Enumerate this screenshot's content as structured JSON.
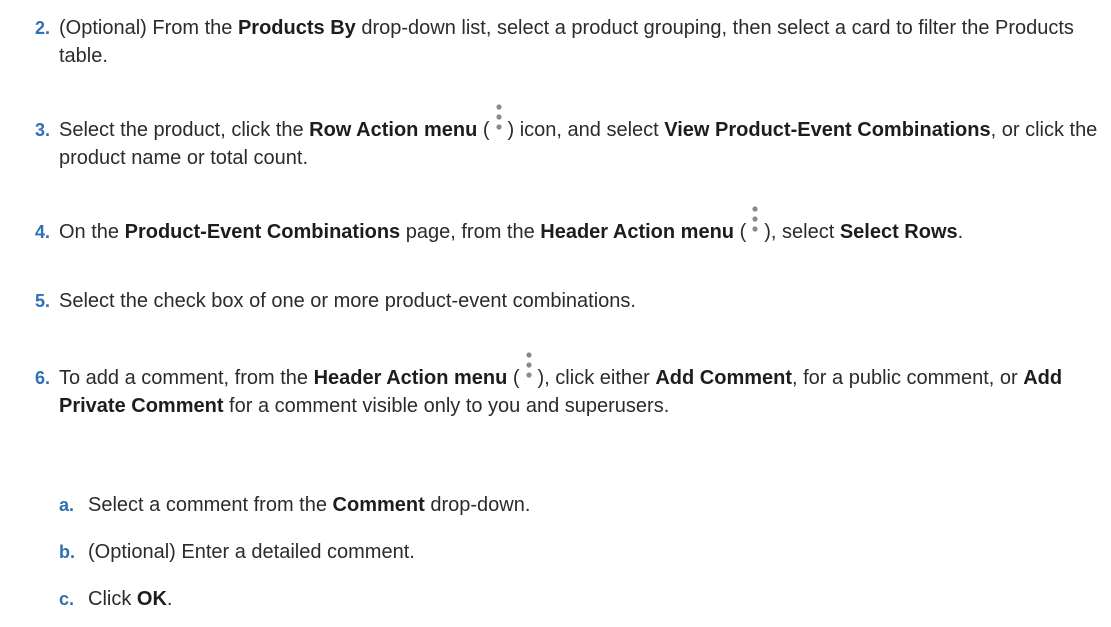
{
  "steps": [
    {
      "number": "2.",
      "parts": [
        {
          "text": "(Optional) From the "
        },
        {
          "text": "Products By",
          "bold": true
        },
        {
          "text": " drop-down list, select a product grouping, then select a card to filter the Products table."
        }
      ]
    },
    {
      "number": "3.",
      "parts": [
        {
          "text": "Select the product, click the "
        },
        {
          "text": "Row Action menu",
          "bold": true
        },
        {
          "text": " ("
        },
        {
          "icon": "kebab-menu-icon"
        },
        {
          "text": ") icon, and select "
        },
        {
          "text": "View Product-Event Combinations",
          "bold": true
        },
        {
          "text": ", or click the product name or total count."
        }
      ]
    },
    {
      "number": "4.",
      "parts": [
        {
          "text": "On the "
        },
        {
          "text": "Product-Event Combinations",
          "bold": true
        },
        {
          "text": " page, from the "
        },
        {
          "text": "Header Action menu",
          "bold": true
        },
        {
          "text": " ("
        },
        {
          "icon": "kebab-menu-icon"
        },
        {
          "text": "), select "
        },
        {
          "text": "Select Rows",
          "bold": true
        },
        {
          "text": "."
        }
      ]
    },
    {
      "number": "5.",
      "parts": [
        {
          "text": "Select the check box of one or more product-event combinations."
        }
      ]
    },
    {
      "number": "6.",
      "parts": [
        {
          "text": "To add a comment, from the "
        },
        {
          "text": "Header Action menu",
          "bold": true
        },
        {
          "text": " ("
        },
        {
          "icon": "kebab-menu-icon"
        },
        {
          "text": "), click either "
        },
        {
          "text": "Add Comment",
          "bold": true
        },
        {
          "text": ", for a public comment, or "
        },
        {
          "text": "Add Private Comment",
          "bold": true
        },
        {
          "text": " for a comment visible only to you and superusers."
        }
      ]
    }
  ],
  "substeps": [
    {
      "letter": "a.",
      "parts": [
        {
          "text": "Select a comment from the "
        },
        {
          "text": "Comment",
          "bold": true
        },
        {
          "text": " drop-down."
        }
      ]
    },
    {
      "letter": "b.",
      "parts": [
        {
          "text": "(Optional) Enter a detailed comment."
        }
      ]
    },
    {
      "letter": "c.",
      "parts": [
        {
          "text": "Click "
        },
        {
          "text": "OK",
          "bold": true
        },
        {
          "text": "."
        }
      ]
    }
  ],
  "colors": {
    "step_number": "#2f6fb3",
    "text": "#2b2b2b",
    "icon_dot": "#8a8a8a"
  }
}
